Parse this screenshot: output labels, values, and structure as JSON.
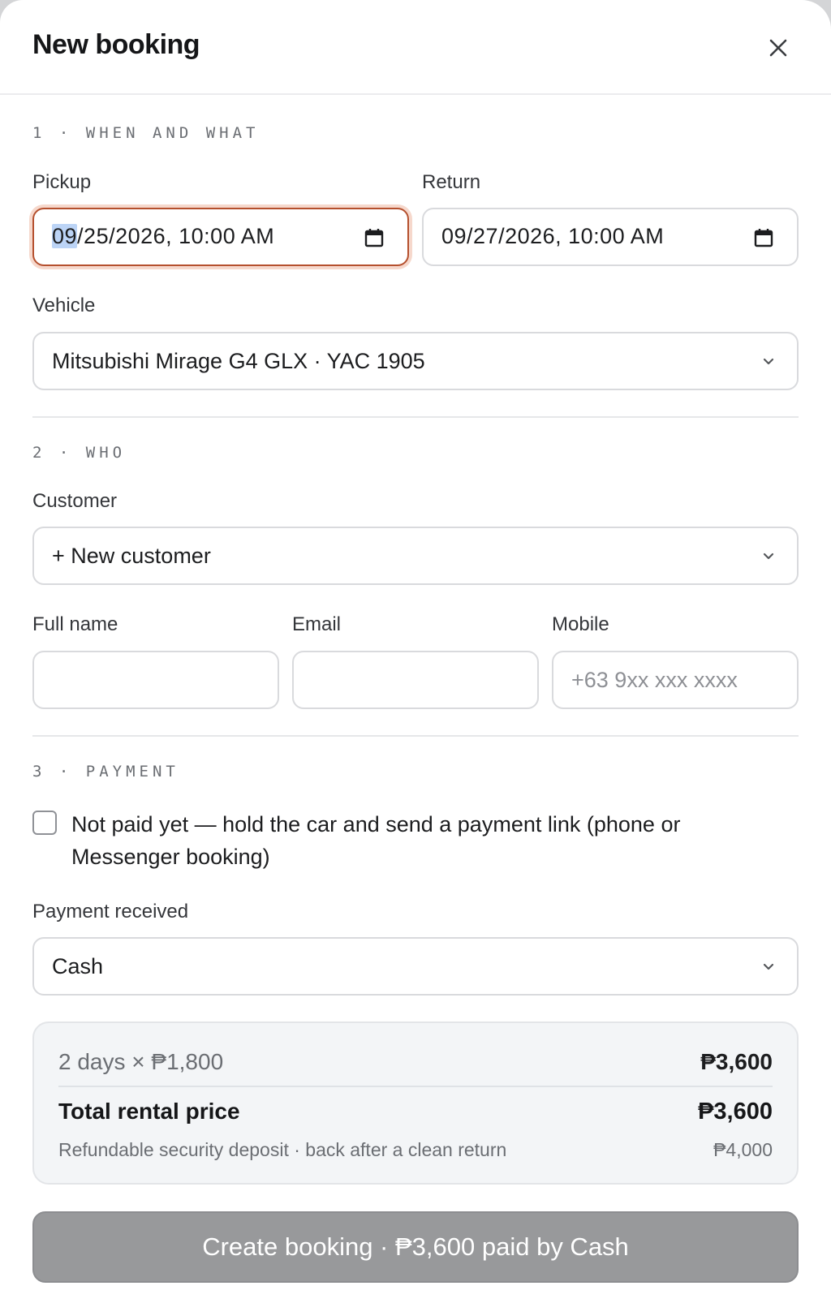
{
  "modal": {
    "title": "New booking"
  },
  "section1": {
    "label": "1 · WHEN AND WHAT",
    "pickup_label": "Pickup",
    "pickup_month": "09",
    "pickup_rest": "/25/2026, 10:00 AM",
    "return_label": "Return",
    "return_value": "09/27/2026, 10:00 AM",
    "vehicle_label": "Vehicle",
    "vehicle_value": "Mitsubishi Mirage G4 GLX · YAC 1905"
  },
  "section2": {
    "label": "2 · WHO",
    "customer_label": "Customer",
    "customer_value": "+ New customer",
    "fullname_label": "Full name",
    "fullname_value": "",
    "email_label": "Email",
    "email_value": "",
    "mobile_label": "Mobile",
    "mobile_placeholder": "+63 9xx xxx xxxx"
  },
  "section3": {
    "label": "3 · PAYMENT",
    "not_paid_checked": false,
    "not_paid_label": "Not paid yet — hold the car and send a payment link (phone or Messenger booking)",
    "payment_label": "Payment received",
    "payment_value": "Cash"
  },
  "summary": {
    "calc_label": "2 days × ₱1,800",
    "calc_value": "₱3,600",
    "total_label": "Total rental price",
    "total_value": "₱3,600",
    "deposit_label": "Refundable security deposit · back after a clean return",
    "deposit_value": "₱4,000"
  },
  "submit": {
    "label": "Create booking · ₱3,600 paid by Cash",
    "disabled": true
  },
  "icons": {
    "close": "close-icon",
    "calendar": "calendar-icon",
    "chevron": "chevron-down-icon"
  },
  "colors": {
    "focus_border": "#b5502e",
    "focus_ring": "#f6d8cc",
    "submit_disabled": "#98999b",
    "summary_bg": "#f3f5f7"
  }
}
